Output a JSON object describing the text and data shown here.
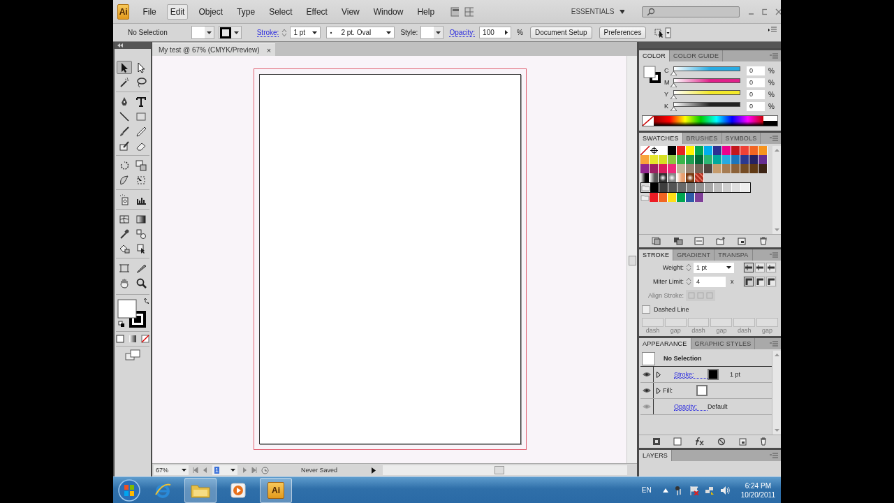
{
  "app_logo": "Ai",
  "menus": [
    {
      "label": "File",
      "highlighted": false
    },
    {
      "label": "Edit",
      "highlighted": true
    },
    {
      "label": "Object",
      "highlighted": false
    },
    {
      "label": "Type",
      "highlighted": false
    },
    {
      "label": "Select",
      "highlighted": false
    },
    {
      "label": "Effect",
      "highlighted": false
    },
    {
      "label": "View",
      "highlighted": false
    },
    {
      "label": "Window",
      "highlighted": false
    },
    {
      "label": "Help",
      "highlighted": false
    }
  ],
  "workspace": "ESSENTIALS",
  "control_bar": {
    "selection": "No Selection",
    "stroke_label": "Stroke:",
    "stroke_weight": "1 pt",
    "brush": "2 pt. Oval",
    "style_label": "Style:",
    "opacity_label": "Opacity:",
    "opacity": "100",
    "percent": "%",
    "buttons": [
      "Document Setup",
      "Preferences"
    ]
  },
  "tools": [
    {
      "selected": true
    },
    {
      "selected": false
    },
    {
      "selected": false
    },
    {
      "selected": false
    },
    {
      "selected": false
    },
    {
      "selected": false
    },
    {
      "selected": false
    },
    {
      "selected": false
    },
    {
      "selected": false
    },
    {
      "selected": false
    },
    {
      "selected": false
    },
    {
      "selected": false
    },
    {
      "selected": false
    },
    {
      "selected": false
    },
    {
      "selected": false
    },
    {
      "selected": false
    },
    {
      "selected": false
    },
    {
      "selected": false
    },
    {
      "selected": false
    },
    {
      "selected": false
    },
    {
      "selected": false
    },
    {
      "selected": false
    },
    {
      "selected": false
    },
    {
      "selected": false
    },
    {
      "selected": false
    },
    {
      "selected": false
    },
    {
      "selected": false
    },
    {
      "selected": false
    }
  ],
  "document": {
    "tab": "My test @ 67% (CMYK/Preview)",
    "close": "×",
    "zoom": "67%",
    "page": "1",
    "status": "Never Saved"
  },
  "color_panel": {
    "tabs": [
      {
        "label": "COLOR",
        "selected": true
      },
      {
        "label": "COLOR GUIDE",
        "selected": false
      }
    ],
    "channels": [
      {
        "name": "C",
        "color": "#29abe2",
        "level": 0,
        "value": "0",
        "unit": "%"
      },
      {
        "name": "M",
        "color": "#e0218a",
        "level": 0,
        "value": "0",
        "unit": "%"
      },
      {
        "name": "Y",
        "color": "#f2e82a",
        "level": 0,
        "value": "0",
        "unit": "%"
      },
      {
        "name": "K",
        "color": "#222222",
        "level": 0,
        "value": "0",
        "unit": "%"
      }
    ]
  },
  "swatches_panel": {
    "tabs": [
      {
        "label": "SWATCHES",
        "selected": true
      },
      {
        "label": "BRUSHES",
        "selected": false
      },
      {
        "label": "SYMBOLS",
        "selected": false
      }
    ],
    "rows": [
      [
        {
          "kind": "none"
        },
        {
          "kind": "registration"
        },
        {
          "kind": "solid",
          "color": "#ffffff"
        },
        {
          "kind": "solid",
          "color": "#000000"
        },
        {
          "kind": "solid",
          "color": "#e52421"
        },
        {
          "kind": "solid",
          "color": "#fff200"
        },
        {
          "kind": "solid",
          "color": "#00a651"
        },
        {
          "kind": "solid",
          "color": "#00aeef"
        },
        {
          "kind": "solid",
          "color": "#2e3192"
        },
        {
          "kind": "solid",
          "color": "#ec008c"
        },
        {
          "kind": "solid",
          "color": "#c4161c"
        },
        {
          "kind": "solid",
          "color": "#ef4136"
        },
        {
          "kind": "solid",
          "color": "#f26522"
        },
        {
          "kind": "solid",
          "color": "#f7941d"
        }
      ],
      [
        {
          "kind": "solid",
          "color": "#f9a33b"
        },
        {
          "kind": "solid",
          "color": "#e6e62a"
        },
        {
          "kind": "solid",
          "color": "#d7df23"
        },
        {
          "kind": "solid",
          "color": "#8dc63f"
        },
        {
          "kind": "solid",
          "color": "#39b54a"
        },
        {
          "kind": "solid",
          "color": "#1c9d4f"
        },
        {
          "kind": "solid",
          "color": "#006838"
        },
        {
          "kind": "solid",
          "color": "#2bb673"
        },
        {
          "kind": "solid",
          "color": "#00a99d"
        },
        {
          "kind": "solid",
          "color": "#27aae1"
        },
        {
          "kind": "solid",
          "color": "#1b75bb"
        },
        {
          "kind": "solid",
          "color": "#2b3990"
        },
        {
          "kind": "solid",
          "color": "#262262"
        },
        {
          "kind": "solid",
          "color": "#662d91"
        }
      ],
      [
        {
          "kind": "solid",
          "color": "#92278f"
        },
        {
          "kind": "solid",
          "color": "#9e1f63"
        },
        {
          "kind": "solid",
          "color": "#da1c5c"
        },
        {
          "kind": "solid",
          "color": "#ee2a7b"
        },
        {
          "kind": "solid",
          "color": "#c2b59b"
        },
        {
          "kind": "solid",
          "color": "#998675"
        },
        {
          "kind": "solid",
          "color": "#736357"
        },
        {
          "kind": "solid",
          "color": "#534741"
        },
        {
          "kind": "solid",
          "color": "#c69c6d"
        },
        {
          "kind": "solid",
          "color": "#a67c52"
        },
        {
          "kind": "solid",
          "color": "#8c6239"
        },
        {
          "kind": "solid",
          "color": "#754c24"
        },
        {
          "kind": "solid",
          "color": "#603913"
        },
        {
          "kind": "solid",
          "color": "#3c2415"
        }
      ],
      [
        {
          "kind": "gradient",
          "color": "#000000"
        },
        {
          "kind": "gradient",
          "color": "#555555"
        },
        {
          "kind": "radial",
          "color": "#333333"
        },
        {
          "kind": "radial",
          "color": "#888888"
        },
        {
          "kind": "gradient",
          "color": "#e8a070"
        },
        {
          "kind": "radial",
          "color": "#7a3a10"
        },
        {
          "kind": "pattern",
          "color": "#b03020"
        }
      ],
      [
        {
          "kind": "folder",
          "color": "#d8d8d8"
        },
        {
          "kind": "solid",
          "color": "#000000"
        },
        {
          "kind": "solid",
          "color": "#3d3d3d"
        },
        {
          "kind": "solid",
          "color": "#545454"
        },
        {
          "kind": "solid",
          "color": "#686868"
        },
        {
          "kind": "solid",
          "color": "#7d7d7d"
        },
        {
          "kind": "solid",
          "color": "#939393"
        },
        {
          "kind": "solid",
          "color": "#a8a8a8"
        },
        {
          "kind": "solid",
          "color": "#bdbdbd"
        },
        {
          "kind": "solid",
          "color": "#cfcfcf"
        },
        {
          "kind": "solid",
          "color": "#dfdfdf"
        },
        {
          "kind": "solid",
          "color": "#efefef"
        }
      ],
      [
        {
          "kind": "folder",
          "color": "#d8d8d8"
        },
        {
          "kind": "solid",
          "color": "#ed1c24"
        },
        {
          "kind": "solid",
          "color": "#f26522"
        },
        {
          "kind": "solid",
          "color": "#ffde17"
        },
        {
          "kind": "solid",
          "color": "#00a651"
        },
        {
          "kind": "solid",
          "color": "#2e5ba8"
        },
        {
          "kind": "solid",
          "color": "#7f3f98"
        }
      ]
    ]
  },
  "stroke_panel": {
    "tabs": [
      {
        "label": "STROKE",
        "selected": true
      },
      {
        "label": "GRADIENT",
        "selected": false
      },
      {
        "label": "TRANSPA",
        "selected": false
      }
    ],
    "weight_label": "Weight:",
    "weight": "1 pt",
    "miter_label": "Miter Limit:",
    "miter": "4",
    "miter_unit": "x",
    "align_label": "Align Stroke:",
    "dashed_label": "Dashed Line",
    "dashed": false,
    "caps": [
      {
        "selected": true
      },
      {
        "selected": false
      },
      {
        "selected": false
      }
    ],
    "joins": [
      {
        "selected": true
      },
      {
        "selected": false
      },
      {
        "selected": false
      }
    ],
    "dash_fields": [
      "dash",
      "gap",
      "dash",
      "gap",
      "dash",
      "gap"
    ]
  },
  "appearance_panel": {
    "tabs": [
      {
        "label": "APPEARANCE",
        "selected": true
      },
      {
        "label": "GRAPHIC STYLES",
        "selected": false
      }
    ],
    "header": "No Selection",
    "rows": [
      {
        "kind": "stroke",
        "label": "Stroke:",
        "color": "#000000",
        "value": "1 pt"
      },
      {
        "kind": "fill",
        "label": "Fill:",
        "color": "#ffffff"
      },
      {
        "kind": "opacity",
        "label": "Opacity:",
        "value": "Default"
      }
    ]
  },
  "layers_panel": {
    "tabs": [
      {
        "label": "LAYERS",
        "selected": true
      }
    ]
  },
  "taskbar": {
    "apps": [
      {
        "highlighted": false
      },
      {
        "highlighted": true
      },
      {
        "highlighted": false
      },
      {
        "highlighted": true,
        "label": "Ai"
      }
    ],
    "language": "EN",
    "time": "6:24 PM",
    "date": "10/20/2011"
  }
}
